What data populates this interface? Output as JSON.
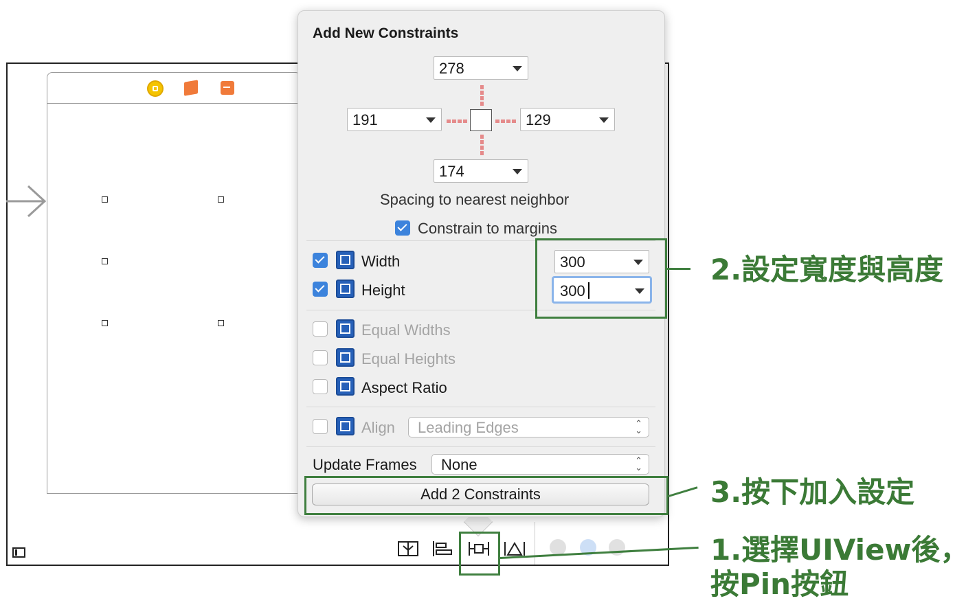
{
  "popover": {
    "title": "Add New Constraints",
    "spacing": {
      "top": "278",
      "left": "191",
      "right": "129",
      "bottom": "174"
    },
    "spacing_caption": "Spacing to nearest neighbor",
    "constrain_margins": {
      "label": "Constrain to margins",
      "checked": true
    },
    "width": {
      "label": "Width",
      "checked": true,
      "value": "300"
    },
    "height": {
      "label": "Height",
      "checked": true,
      "value": "300"
    },
    "equal_widths": {
      "label": "Equal Widths",
      "checked": false,
      "enabled": false
    },
    "equal_heights": {
      "label": "Equal Heights",
      "checked": false,
      "enabled": false
    },
    "aspect_ratio": {
      "label": "Aspect Ratio",
      "checked": false
    },
    "align": {
      "label": "Align",
      "value": "Leading Edges",
      "enabled": false
    },
    "update_frames": {
      "label": "Update Frames",
      "value": "None"
    },
    "add_button": "Add 2 Constraints"
  },
  "annotations": {
    "step2": "2.設定寬度與高度",
    "step3": "3.按下加入設定",
    "step1_line1": "1.選擇UIView後，",
    "step1_line2": "按Pin按鈕",
    "color": "#3b7a36"
  },
  "toolbar": {
    "icons": [
      "stack-icon",
      "align-icon",
      "pin-icon",
      "resolve-issues-icon"
    ]
  },
  "scene": {
    "icons": [
      "view-controller-icon",
      "first-responder-icon",
      "exit-icon"
    ]
  }
}
